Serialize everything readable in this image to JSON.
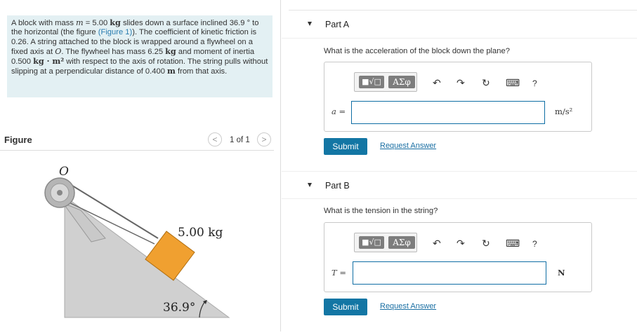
{
  "problem": {
    "text_1": "A block with mass ",
    "m_sym": "m",
    "text_2": " = 5.00 ",
    "kg": "kg",
    "text_3": " slides down a surface inclined 36.9 ° to the horizontal (the figure ",
    "figure_link": "(Figure 1)",
    "text_4": "). The coefficient of kinetic friction is 0.26. A string attached to the block is wrapped around a flywheel on a fixed axis at ",
    "o_sym": "O",
    "text_5": ". The flywheel has mass 6.25 ",
    "text_6": " and moment of inertia 0.500 ",
    "inertia_unit": "kg · m²",
    "text_7": " with respect to the axis of rotation. The string pulls without slipping at a perpendicular distance of 0.400 ",
    "m_unit": "m",
    "text_8": " from that axis."
  },
  "figure_panel": {
    "title": "Figure",
    "pager": "1 of 1",
    "prev": "<",
    "next": ">",
    "label_o": "O",
    "label_mass": "5.00 kg",
    "label_angle": "36.9°"
  },
  "toolbar": {
    "sqrt_label": "■√□",
    "greek_label": "ΑΣφ",
    "undo": "↶",
    "redo": "↷",
    "reset": "↻",
    "keyboard": "⌨",
    "help": "?"
  },
  "part_a": {
    "label": "Part A",
    "question": "What is the acceleration of the block down the plane?",
    "var": "a =",
    "input_value": "",
    "unit": "m/s²",
    "submit": "Submit",
    "request": "Request Answer"
  },
  "part_b": {
    "label": "Part B",
    "question": "What is the tension in the string?",
    "var": "T =",
    "input_value": "",
    "unit": "N",
    "submit": "Submit",
    "request": "Request Answer"
  },
  "colors": {
    "problem_bg": "#e3f0f3",
    "link": "#2a7db0",
    "submit_bg": "#1376a4",
    "input_border": "#0f6ea4",
    "block_fill": "#f0a030",
    "ramp_fill": "#d0d0d0"
  }
}
